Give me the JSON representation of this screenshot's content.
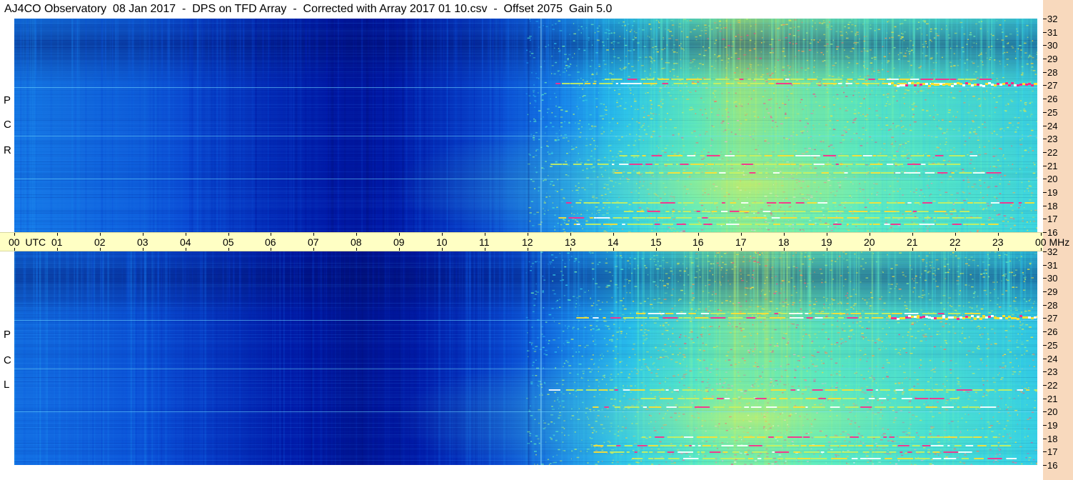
{
  "title": "AJ4CO Observatory  08 Jan 2017  -  DPS on TFD Array  -  Corrected with Array 2017 01 10.csv  -  Offset 2075  Gain 5.0",
  "chart_data": {
    "type": "heatmap",
    "title": "AJ4CO Observatory  08 Jan 2017  -  DPS on TFD Array  -  Corrected with Array 2017 01 10.csv  -  Offset 2075  Gain 5.0",
    "xlabel": "UTC",
    "ylabel": "MHz",
    "xlim": [
      0,
      24
    ],
    "ylim": [
      16,
      32
    ],
    "x_ticks": [
      "00",
      "01",
      "02",
      "03",
      "04",
      "05",
      "06",
      "07",
      "08",
      "09",
      "10",
      "11",
      "12",
      "13",
      "14",
      "15",
      "16",
      "17",
      "18",
      "19",
      "20",
      "21",
      "22",
      "23",
      "00"
    ],
    "y_ticks": [
      "32",
      "31",
      "30",
      "29",
      "28",
      "27",
      "26",
      "25",
      "24",
      "23",
      "22",
      "21",
      "20",
      "19",
      "18",
      "17",
      "16"
    ],
    "panels": [
      {
        "name": "R C P",
        "letters": [
          "R",
          "C",
          "P"
        ]
      },
      {
        "name": "L C P",
        "letters": [
          "L",
          "C",
          "P"
        ]
      }
    ],
    "axis_unit_x": "UTC",
    "axis_unit_y": "MHz",
    "colormap": [
      "#000a5a",
      "#0018a8",
      "#0a4fd8",
      "#1a8ef0",
      "#2ccbf0",
      "#5ef0c0",
      "#c8f060",
      "#ffe030",
      "#ff3080",
      "#ffffff"
    ],
    "intensity_profile_hours": [
      0,
      3,
      6,
      8,
      9,
      11,
      12.3,
      15,
      17,
      20,
      23,
      24
    ],
    "intensity_profile_level": [
      0.3,
      0.25,
      0.15,
      0.1,
      0.12,
      0.2,
      0.28,
      0.5,
      0.62,
      0.55,
      0.5,
      0.48
    ]
  }
}
